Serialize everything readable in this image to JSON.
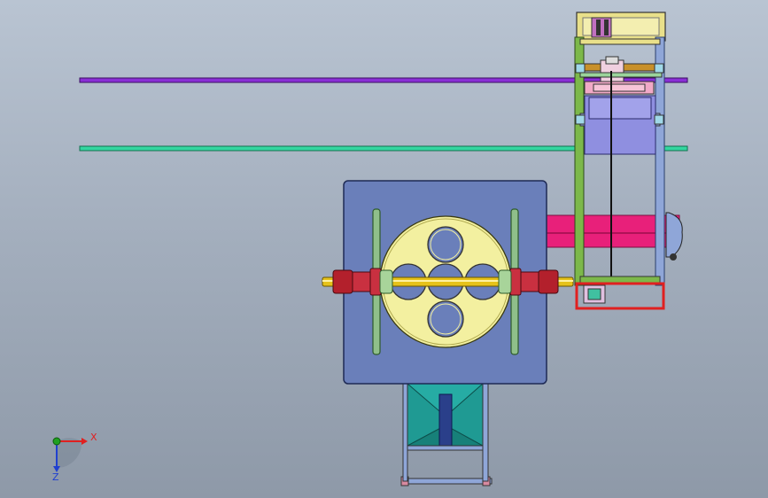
{
  "viewport": {
    "background_top": "#b9c4d2",
    "background_bottom": "#8e99a8"
  },
  "colors": {
    "rail_purple": "#8a2fd6",
    "rail_green": "#33d6a0",
    "base_plate": "#6a7fba",
    "wheel_yellow": "#f3f0a0",
    "shaft_yellow": "#e6c21a",
    "bearing_red": "#b3202c",
    "flange_green": "#8fbf8a",
    "belt_pink": "#e8207a",
    "hopper_teal": "#1f9a93",
    "frame_green": "#7cb84a",
    "frame_blue": "#8fa6d8",
    "frame_yellow": "#e9e08a",
    "frame_red": "#e02020",
    "axis_x": "#e02020",
    "axis_y": "#20a020",
    "axis_z": "#2040d0"
  },
  "axis_triad": {
    "x_label": "X",
    "z_label": "Z",
    "icons": [
      "axis-triad-icon"
    ]
  }
}
